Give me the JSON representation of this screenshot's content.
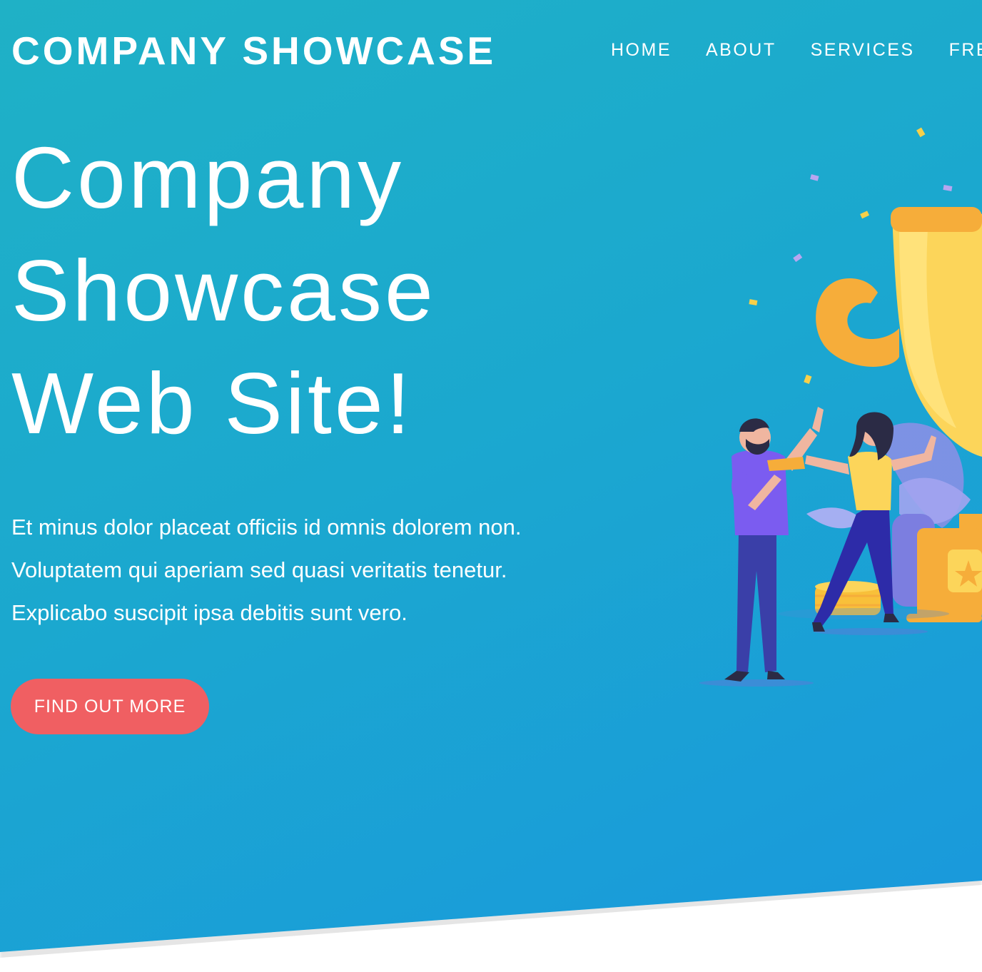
{
  "navbar": {
    "brand": "COMPANY SHOWCASE",
    "links": [
      "HOME",
      "ABOUT",
      "SERVICES",
      "FREQ"
    ]
  },
  "hero": {
    "title_lines": [
      "Company",
      "Showcase",
      "Web Site!"
    ],
    "text_lines": [
      "Et minus dolor placeat officiis id omnis dolorem non.",
      "Voluptatem qui aperiam sed quasi veritatis tenetur.",
      "Explicabo suscipit ipsa debitis sunt vero."
    ],
    "cta_label": "FIND OUT MORE",
    "illustration": "trophy-celebration-illustration"
  },
  "colors": {
    "gradient_start": "#1fb1c6",
    "gradient_end": "#1a98dd",
    "cta": "#f05f62",
    "text": "#ffffff"
  }
}
